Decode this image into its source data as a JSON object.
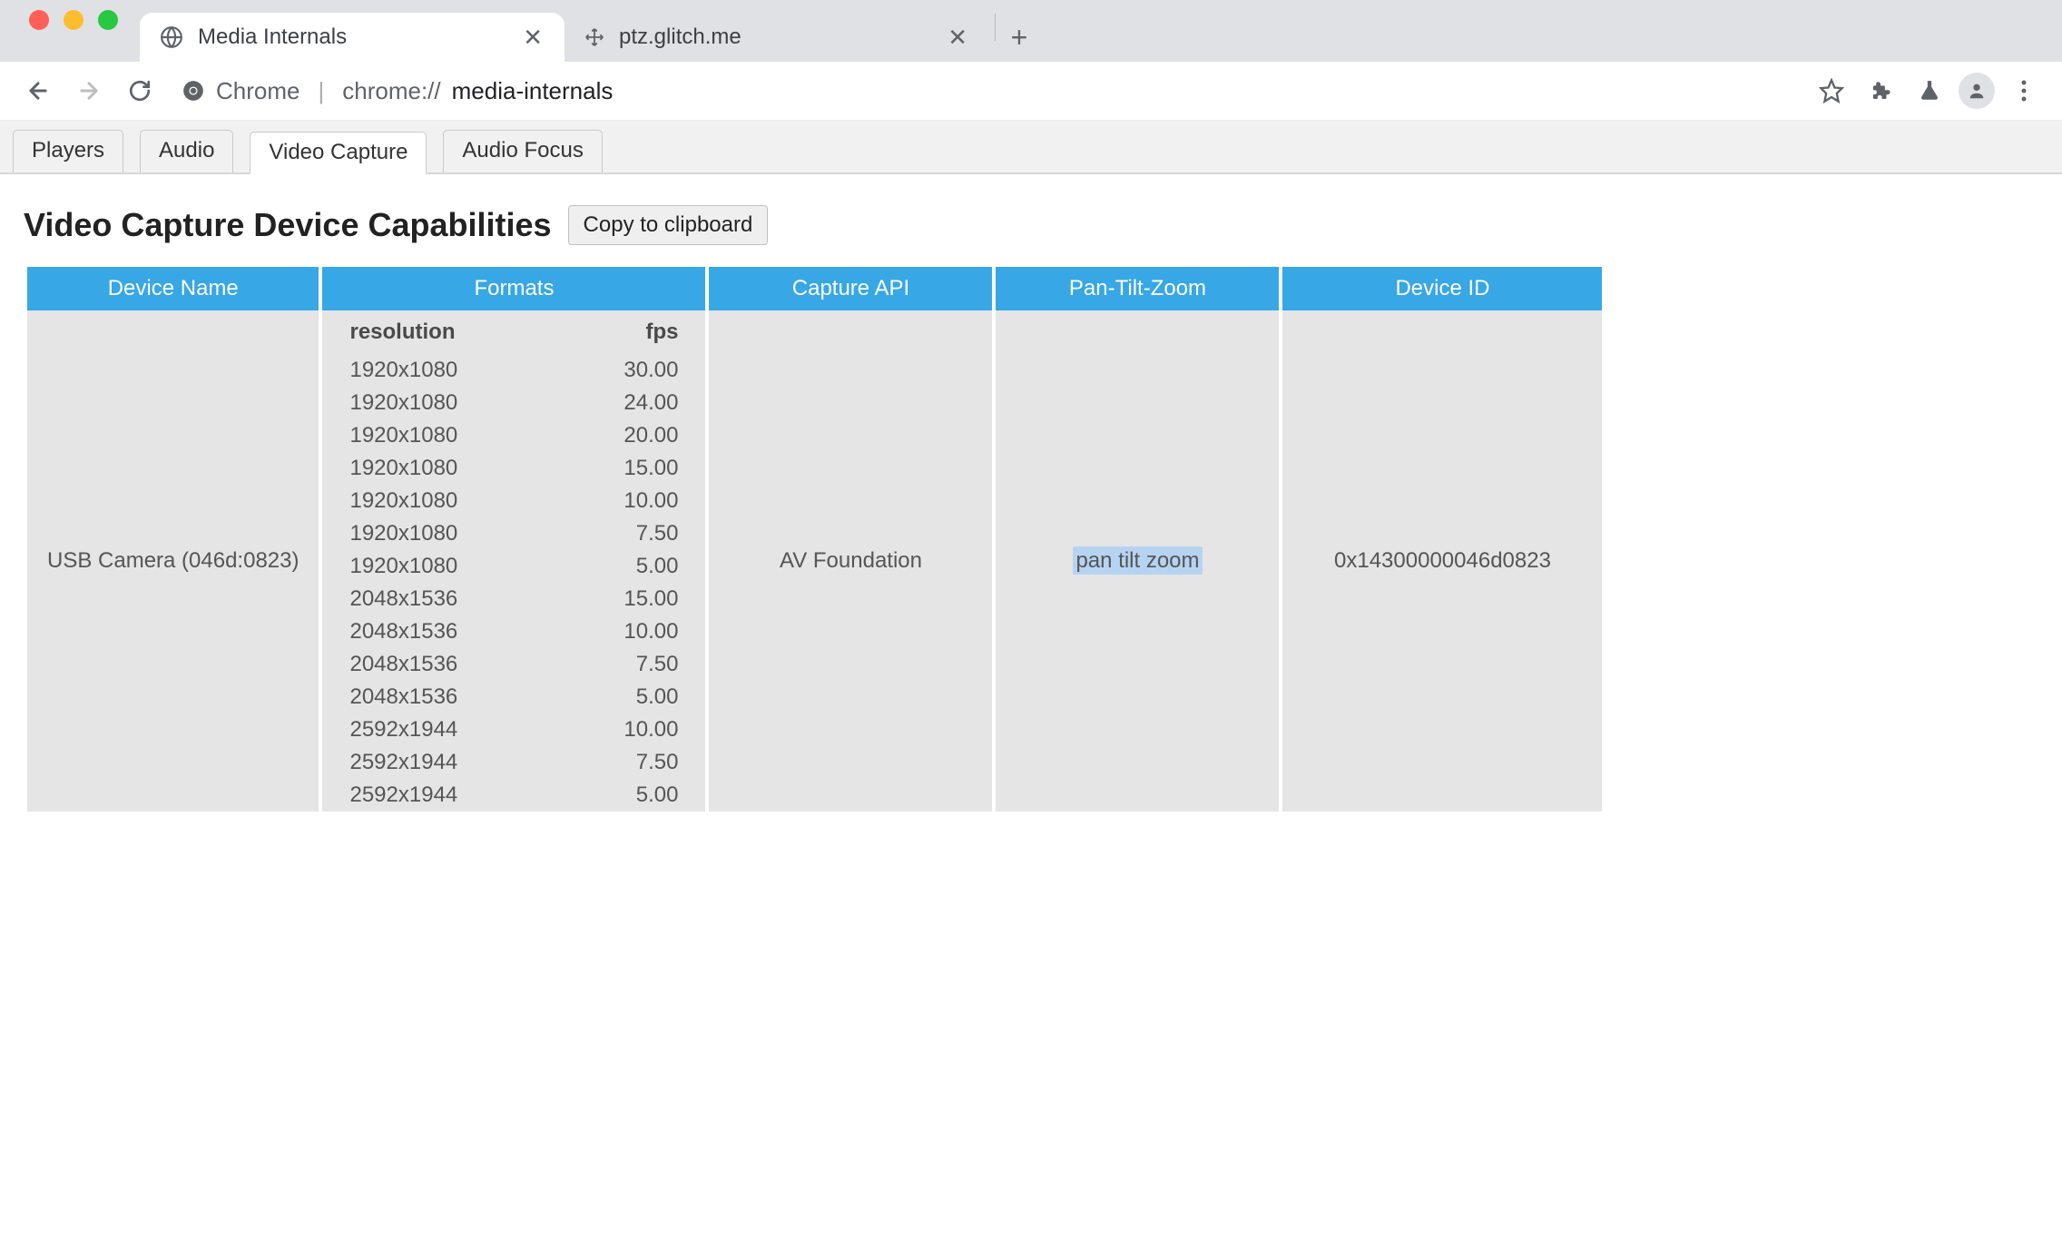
{
  "browser_tabs": [
    {
      "title": "Media Internals",
      "active": true
    },
    {
      "title": "ptz.glitch.me",
      "active": false
    }
  ],
  "url_bar": {
    "origin_label": "Chrome",
    "scheme": "chrome://",
    "path": "media-internals"
  },
  "subtabs": [
    {
      "label": "Players",
      "active": false
    },
    {
      "label": "Audio",
      "active": false
    },
    {
      "label": "Video Capture",
      "active": true
    },
    {
      "label": "Audio Focus",
      "active": false
    }
  ],
  "heading": "Video Capture Device Capabilities",
  "copy_button": "Copy to clipboard",
  "columns": [
    "Device Name",
    "Formats",
    "Capture API",
    "Pan-Tilt-Zoom",
    "Device ID"
  ],
  "format_columns": [
    "resolution",
    "fps"
  ],
  "device": {
    "name": "USB Camera (046d:0823)",
    "capture_api": "AV Foundation",
    "pan_tilt_zoom": "pan tilt zoom",
    "device_id": "0x14300000046d0823",
    "formats": [
      {
        "resolution": "1920x1080",
        "fps": "30.00"
      },
      {
        "resolution": "1920x1080",
        "fps": "24.00"
      },
      {
        "resolution": "1920x1080",
        "fps": "20.00"
      },
      {
        "resolution": "1920x1080",
        "fps": "15.00"
      },
      {
        "resolution": "1920x1080",
        "fps": "10.00"
      },
      {
        "resolution": "1920x1080",
        "fps": "7.50"
      },
      {
        "resolution": "1920x1080",
        "fps": "5.00"
      },
      {
        "resolution": "2048x1536",
        "fps": "15.00"
      },
      {
        "resolution": "2048x1536",
        "fps": "10.00"
      },
      {
        "resolution": "2048x1536",
        "fps": "7.50"
      },
      {
        "resolution": "2048x1536",
        "fps": "5.00"
      },
      {
        "resolution": "2592x1944",
        "fps": "10.00"
      },
      {
        "resolution": "2592x1944",
        "fps": "7.50"
      },
      {
        "resolution": "2592x1944",
        "fps": "5.00"
      }
    ]
  }
}
